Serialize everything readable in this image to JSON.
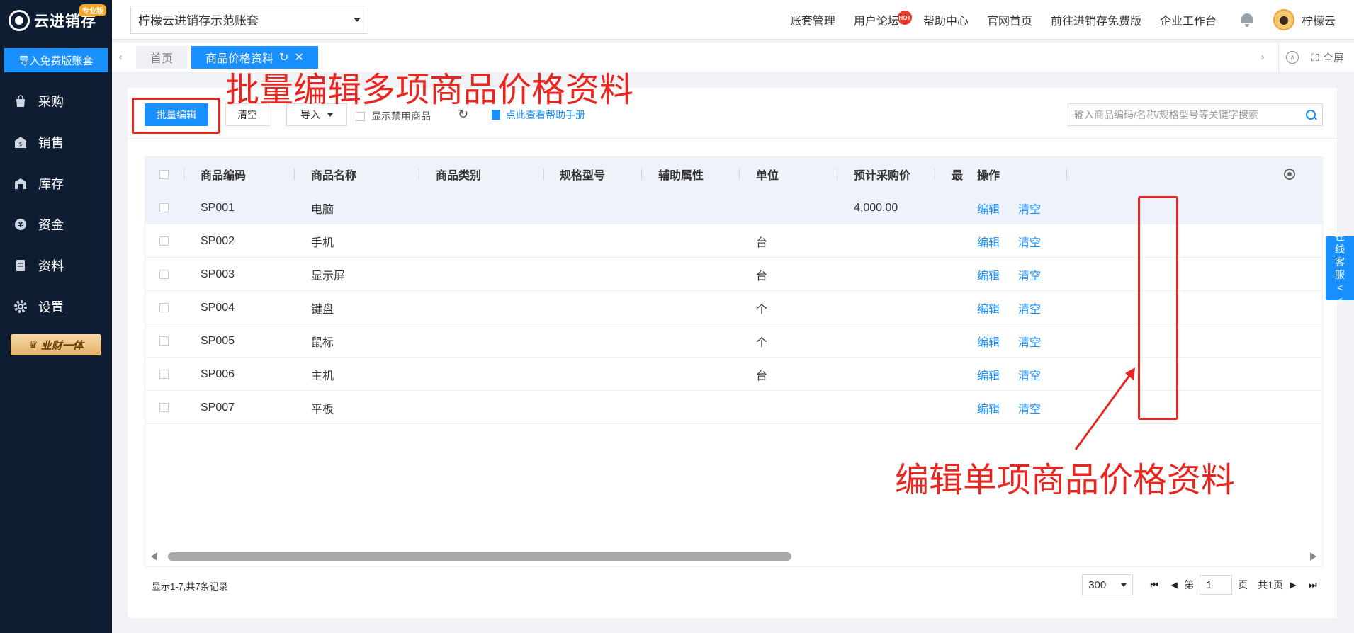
{
  "sidebar": {
    "logo_text": "云进销存",
    "pro_badge": "专业版",
    "import_button": "导入免费版账套",
    "items": [
      {
        "label": "采购",
        "icon": "bag-icon"
      },
      {
        "label": "销售",
        "icon": "sales-icon"
      },
      {
        "label": "库存",
        "icon": "warehouse-icon"
      },
      {
        "label": "资金",
        "icon": "yen-icon"
      },
      {
        "label": "资料",
        "icon": "document-icon"
      },
      {
        "label": "设置",
        "icon": "gear-icon"
      }
    ],
    "promo": "业财一体"
  },
  "topbar": {
    "account": "柠檬云进销存示范账套",
    "links": [
      "账套管理",
      "用户论坛",
      "帮助中心",
      "官网首页",
      "前往进销存免费版",
      "企业工作台"
    ],
    "hot_badge": "HOT",
    "username": "柠檬云"
  },
  "tabs": {
    "home": "首页",
    "active": "商品价格资料",
    "fullscreen": "全屏"
  },
  "toolbar": {
    "batch_edit": "批量编辑",
    "clear": "清空",
    "import": "导入",
    "show_disabled": "显示禁用商品",
    "help_link": "点此查看帮助手册",
    "search_placeholder": "输入商品编码/名称/规格型号等关键字搜索"
  },
  "table": {
    "columns": [
      "商品编码",
      "商品名称",
      "商品类别",
      "规格型号",
      "辅助属性",
      "单位",
      "预计采购价",
      "最",
      "操作"
    ],
    "rows": [
      {
        "code": "SP001",
        "name": "电脑",
        "unit": "",
        "price": "4,000.00"
      },
      {
        "code": "SP002",
        "name": "手机",
        "unit": "台",
        "price": ""
      },
      {
        "code": "SP003",
        "name": "显示屏",
        "unit": "台",
        "price": ""
      },
      {
        "code": "SP004",
        "name": "键盘",
        "unit": "个",
        "price": ""
      },
      {
        "code": "SP005",
        "name": "鼠标",
        "unit": "个",
        "price": ""
      },
      {
        "code": "SP006",
        "name": "主机",
        "unit": "台",
        "price": ""
      },
      {
        "code": "SP007",
        "name": "平板",
        "unit": "",
        "price": ""
      }
    ],
    "action_edit": "编辑",
    "action_clear": "清空"
  },
  "footer": {
    "record_info": "显示1-7,共7条记录",
    "page_size": "300",
    "page_prefix": "第",
    "page_value": "1",
    "page_suffix": "页",
    "total_pages": "共1页"
  },
  "service_tab": "在线客服<<",
  "annotations": {
    "batch": "批量编辑多项商品价格资料",
    "single": "编辑单项商品价格资料"
  },
  "colors": {
    "primary": "#1890ff",
    "sidebar": "#0f1d33",
    "annotation": "#e8261f"
  }
}
